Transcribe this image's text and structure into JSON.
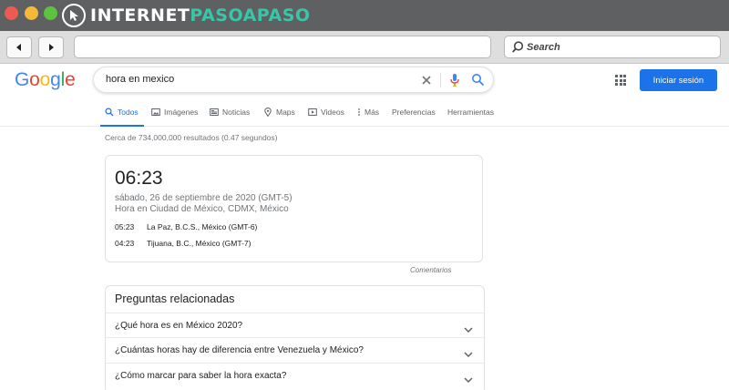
{
  "window": {
    "brand_main": "INTERNET",
    "brand_accent": "PASOAPASO",
    "brand_colors": {
      "text": "#ffffff",
      "accent": "#39c6a8"
    },
    "titlebar_color": "#5f6062"
  },
  "browser": {
    "back_icon": "back-arrow-icon",
    "forward_icon": "forward-arrow-icon",
    "url_value": "",
    "search_label": "Search"
  },
  "google": {
    "logo_letters": [
      "G",
      "o",
      "o",
      "g",
      "l",
      "e"
    ],
    "query": "hora en mexico",
    "signin_label": "Iniciar sesión",
    "accent_color": "#1a73e8",
    "tabs": [
      {
        "label": "Todos",
        "icon": "search-icon",
        "active": true
      },
      {
        "label": "Imágenes",
        "icon": "image-icon",
        "active": false
      },
      {
        "label": "Noticias",
        "icon": "news-icon",
        "active": false
      },
      {
        "label": "Maps",
        "icon": "map-pin-icon",
        "active": false
      },
      {
        "label": "Videos",
        "icon": "video-icon",
        "active": false
      },
      {
        "label": "Más",
        "icon": "more-dots-icon",
        "active": false
      },
      {
        "label": "Preferencias",
        "icon": "",
        "active": false
      },
      {
        "label": "Herramientas",
        "icon": "",
        "active": false
      }
    ],
    "result_stats": "Cerca de 734,000,000 resultados (0.47 segundos)",
    "time_card": {
      "time": "06:23",
      "date": "sábado, 26 de septiembre de 2020 (GMT-5)",
      "location": "Hora en Ciudad de México, CDMX, México",
      "others": [
        {
          "time": "05:23",
          "place": "La Paz, B.C.S., México (GMT-6)"
        },
        {
          "time": "04:23",
          "place": "Tijuana, B.C., México (GMT-7)"
        }
      ],
      "feedback_label": "Comentarios"
    },
    "related": {
      "title": "Preguntas relacionadas",
      "questions": [
        "¿Qué hora es en México 2020?",
        "¿Cuántas horas hay de diferencia entre Venezuela y México?",
        "¿Cómo marcar para saber la hora exacta?"
      ]
    }
  }
}
